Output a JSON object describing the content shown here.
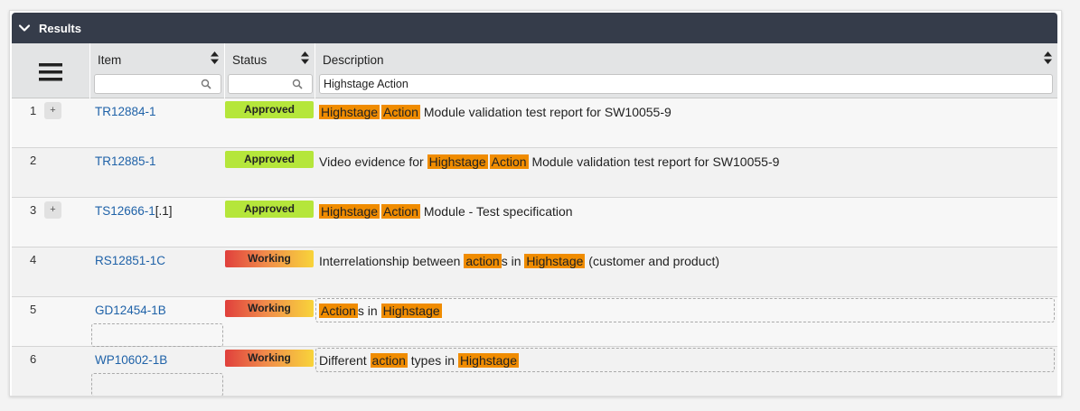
{
  "panel": {
    "title": "Results",
    "collapse_icon": "chevron-down-icon"
  },
  "columns": {
    "menu_icon": "hamburger-menu-icon",
    "item": {
      "label": "Item",
      "filter_value": "",
      "filter_placeholder": ""
    },
    "status": {
      "label": "Status",
      "filter_value": "",
      "filter_placeholder": ""
    },
    "description": {
      "label": "Description",
      "filter_value": "Highstage Action"
    }
  },
  "colors": {
    "header_bg": "#353c4a",
    "link": "#1f62a8",
    "highlight": "#f08c00",
    "approved": "#b5e63b",
    "working_start": "#e0403c",
    "working_end": "#f8d43a"
  },
  "rows": [
    {
      "num": "1",
      "has_plus": true,
      "plus_label": "+",
      "item": "TR12884-1",
      "item_suffix": "",
      "status": "Approved",
      "status_kind": "approved",
      "description": [
        {
          "text": "Highstage",
          "hl": true
        },
        {
          "text": "Action",
          "hl": true
        },
        {
          "text": " Module validation test report for SW10055-9",
          "hl": false
        }
      ],
      "dashed": false
    },
    {
      "num": "2",
      "has_plus": false,
      "plus_label": "",
      "item": "TR12885-1",
      "item_suffix": "",
      "status": "Approved",
      "status_kind": "approved",
      "description": [
        {
          "text": "Video evidence for ",
          "hl": false
        },
        {
          "text": "Highstage",
          "hl": true
        },
        {
          "text": "Action",
          "hl": true
        },
        {
          "text": " Module validation test report for SW10055-9",
          "hl": false
        }
      ],
      "dashed": false
    },
    {
      "num": "3",
      "has_plus": true,
      "plus_label": "+",
      "item": "TS12666-1",
      "item_suffix": "[.1]",
      "status": "Approved",
      "status_kind": "approved",
      "description": [
        {
          "text": "Highstage",
          "hl": true
        },
        {
          "text": "Action",
          "hl": true
        },
        {
          "text": " Module - Test specification",
          "hl": false
        }
      ],
      "dashed": false
    },
    {
      "num": "4",
      "has_plus": false,
      "plus_label": "",
      "item": "RS12851-1C",
      "item_suffix": "",
      "status": "Working",
      "status_kind": "working",
      "description": [
        {
          "text": "Interrelationship between ",
          "hl": false
        },
        {
          "text": "action",
          "hl": true
        },
        {
          "text": "s in ",
          "hl": false
        },
        {
          "text": "Highstage",
          "hl": true
        },
        {
          "text": " (customer and product)",
          "hl": false
        }
      ],
      "dashed": false
    },
    {
      "num": "5",
      "has_plus": false,
      "plus_label": "",
      "item": "GD12454-1B",
      "item_suffix": "",
      "status": "Working",
      "status_kind": "working",
      "description": [
        {
          "text": "Action",
          "hl": true
        },
        {
          "text": "s in ",
          "hl": false
        },
        {
          "text": "Highstage",
          "hl": true
        }
      ],
      "dashed": true
    },
    {
      "num": "6",
      "has_plus": false,
      "plus_label": "",
      "item": "WP10602-1B",
      "item_suffix": "",
      "status": "Working",
      "status_kind": "working",
      "description": [
        {
          "text": "Different ",
          "hl": false
        },
        {
          "text": "action",
          "hl": true
        },
        {
          "text": " types in ",
          "hl": false
        },
        {
          "text": "Highstage",
          "hl": true
        }
      ],
      "dashed": true
    }
  ]
}
